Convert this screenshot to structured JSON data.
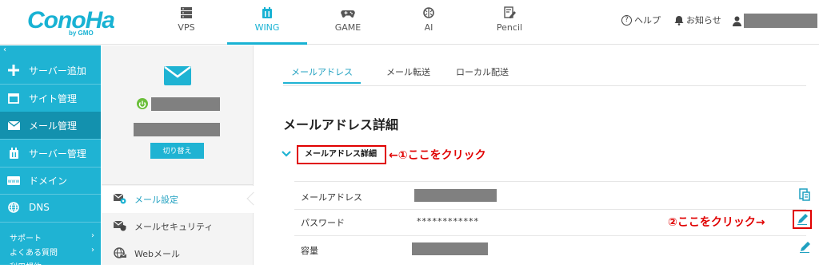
{
  "header": {
    "logo_main": "ConoHa",
    "logo_sub": "by GMO",
    "tabs": [
      {
        "label": "VPS",
        "icon": "server-icon"
      },
      {
        "label": "WING",
        "icon": "wing-icon"
      },
      {
        "label": "GAME",
        "icon": "gamepad-icon"
      },
      {
        "label": "AI",
        "icon": "ai-brain-icon"
      },
      {
        "label": "Pencil",
        "icon": "pencil-doc-icon"
      }
    ],
    "help_label": "ヘルプ",
    "notice_label": "お知らせ"
  },
  "sidebar": {
    "collapse": "‹",
    "items": [
      {
        "label": "サーバー追加"
      },
      {
        "label": "サイト管理"
      },
      {
        "label": "メール管理"
      },
      {
        "label": "サーバー管理"
      },
      {
        "label": "ドメイン"
      },
      {
        "label": "DNS"
      }
    ],
    "small": [
      {
        "label": "サポート",
        "arrow": "›"
      },
      {
        "label": "よくある質問",
        "arrow": "›"
      },
      {
        "label": "利用規約",
        "arrow": ""
      }
    ]
  },
  "mid": {
    "switch_label": "切り替え",
    "menu": [
      {
        "label": "メール設定"
      },
      {
        "label": "メールセキュリティ"
      },
      {
        "label": "Webメール"
      }
    ]
  },
  "main": {
    "tabs": [
      {
        "label": "メールアドレス"
      },
      {
        "label": "メール転送"
      },
      {
        "label": "ローカル配送"
      }
    ],
    "title": "メールアドレス詳細",
    "accordion_label": "メールアドレス詳細",
    "annotation1": "←①ここをクリック",
    "annotation2": "②ここをクリック→",
    "rows": [
      {
        "label": "メールアドレス",
        "value": ""
      },
      {
        "label": "パスワード",
        "value": "************"
      },
      {
        "label": "容量",
        "value": ""
      }
    ]
  },
  "colors": {
    "accent": "#1fb3d3",
    "sidebar_active": "#1391ae",
    "annotation": "#e00000"
  }
}
